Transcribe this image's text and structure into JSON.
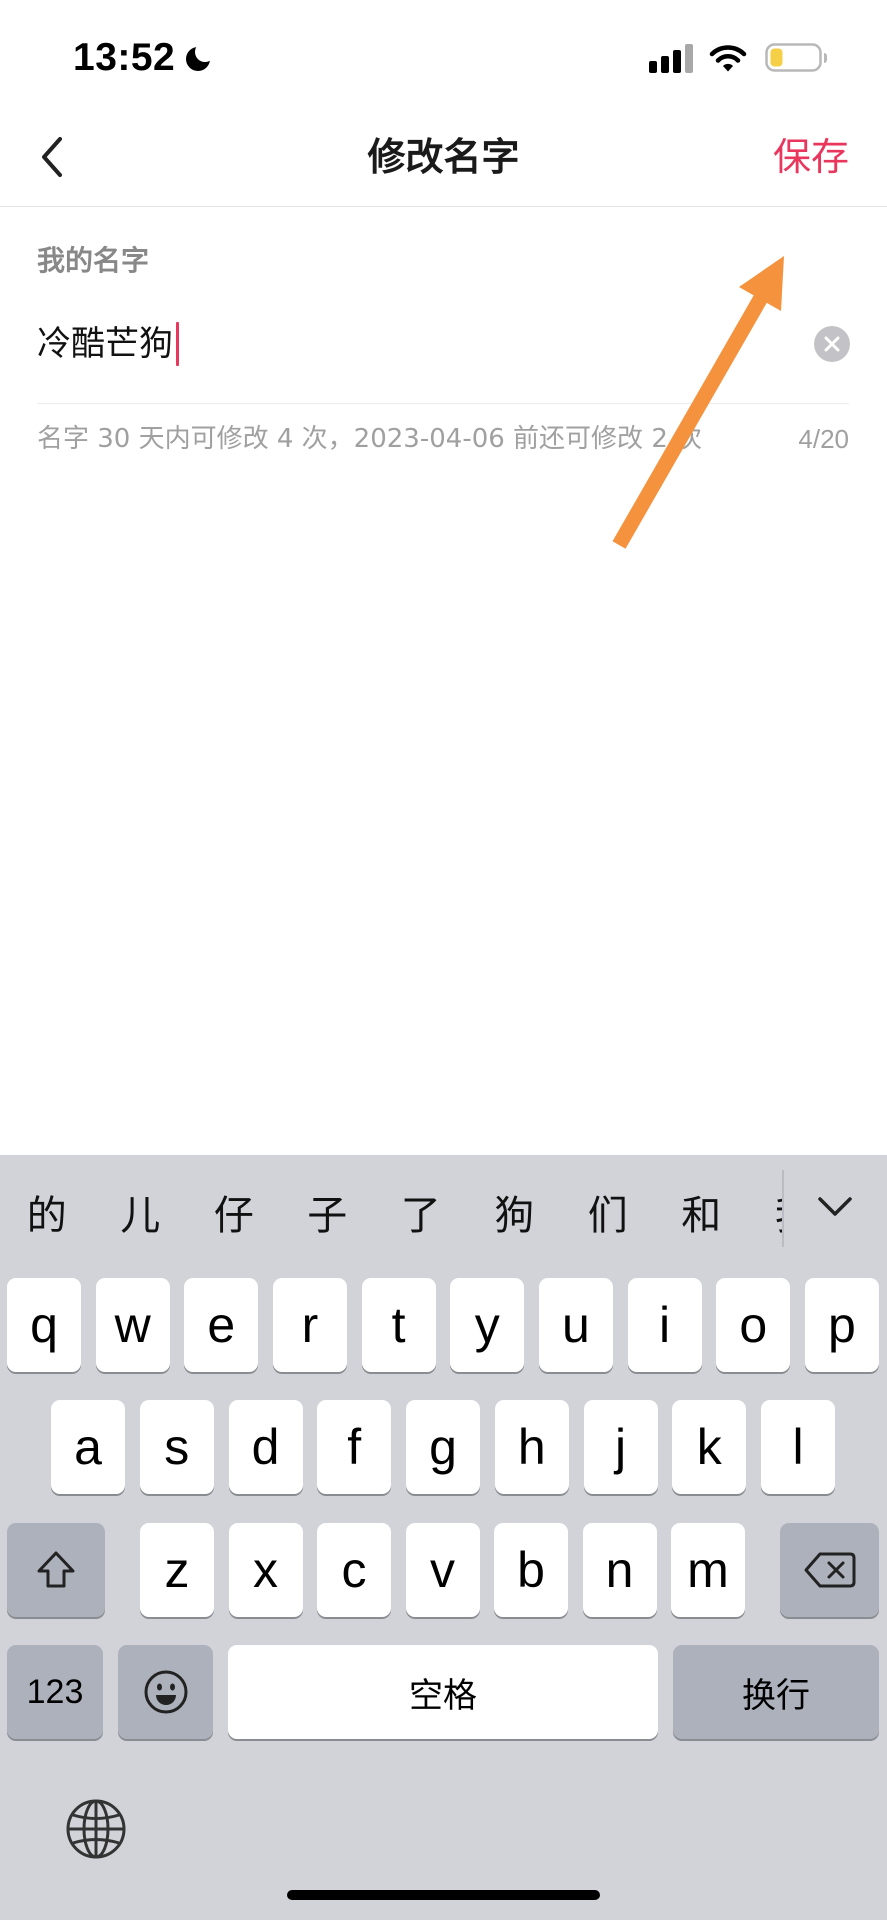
{
  "status_bar": {
    "time": "13:52",
    "moon_icon": "moon-icon",
    "signal_icon": "cellular-signal-icon",
    "wifi_icon": "wifi-icon",
    "battery_icon": "battery-icon",
    "battery_fill_color": "#f5cf46"
  },
  "nav": {
    "back_icon": "chevron-left-icon",
    "title": "修改名字",
    "save_label": "保存"
  },
  "form": {
    "label": "我的名字",
    "value": "冷酷芒狗",
    "clear_icon": "clear-circle-icon",
    "hint": "名字 30 天内可修改 4 次，2023-04-06 前还可修改 2 次",
    "counter": "4/20"
  },
  "keyboard": {
    "candidates": [
      "的",
      "儿",
      "仔",
      "子",
      "了",
      "狗",
      "们",
      "和",
      "我"
    ],
    "collapse_icon": "chevron-down-icon",
    "rows": [
      [
        "q",
        "w",
        "e",
        "r",
        "t",
        "y",
        "u",
        "i",
        "o",
        "p"
      ],
      [
        "a",
        "s",
        "d",
        "f",
        "g",
        "h",
        "j",
        "k",
        "l"
      ],
      [
        "z",
        "x",
        "c",
        "v",
        "b",
        "n",
        "m"
      ]
    ],
    "shift_icon": "shift-icon",
    "delete_icon": "delete-icon",
    "numbers_label": "123",
    "emoji_icon": "emoji-icon",
    "space_label": "空格",
    "return_label": "换行",
    "globe_icon": "globe-icon"
  },
  "annotation": {
    "arrow_icon": "arrow-icon",
    "color": "#f5923e"
  },
  "colors": {
    "accent": "#e8365d",
    "keyboard_bg": "#d1d3d9",
    "key_bg": "#ffffff",
    "special_key_bg": "#acb1bb",
    "hint_text": "#a0a0a0"
  }
}
